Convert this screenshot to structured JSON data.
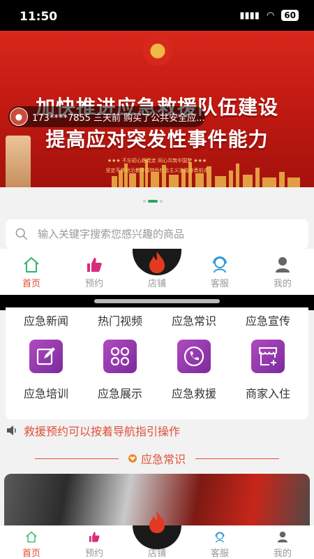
{
  "status": {
    "time": "11:50",
    "battery": "60"
  },
  "banner": {
    "line1": "加快推进应急救援队伍建设",
    "line2": "提高应对突发性事件能力",
    "slogan1": "★★★ 不忘初心跟党走 同心共筑中国梦 ★★★",
    "slogan2": "坚定不移地沿着中国特色社会主义道路奋勇前进"
  },
  "ticker": {
    "text": "173****7855 三天前 购买了公共安全应..."
  },
  "carousel": {
    "count": 3,
    "active": 1
  },
  "search": {
    "placeholder": "输入关键字搜索您感兴趣的商品"
  },
  "tabs": [
    {
      "label": "首页",
      "icon": "home-icon",
      "active": true
    },
    {
      "label": "预约",
      "icon": "thumbs-up-icon",
      "active": false
    },
    {
      "label": "店铺",
      "icon": "flame-logo-icon",
      "active": false
    },
    {
      "label": "客服",
      "icon": "headset-icon",
      "active": false
    },
    {
      "label": "我的",
      "icon": "person-icon",
      "active": false
    }
  ],
  "grid": {
    "row1": [
      "应急新闻",
      "热门视频",
      "应急常识",
      "应急宣传"
    ],
    "row2": [
      {
        "label": "应急培训",
        "icon": "edit-icon"
      },
      {
        "label": "应急展示",
        "icon": "clover-icon"
      },
      {
        "label": "应急救援",
        "icon": "phone-icon"
      },
      {
        "label": "商家入住",
        "icon": "store-add-icon"
      }
    ]
  },
  "notice": {
    "text": "救援预约可以按着导航指引操作"
  },
  "section": {
    "title": "应急常识"
  },
  "colors": {
    "accent": "#e0503a",
    "tab_active": "#e04a2e",
    "icon_purple": "#8e36a8"
  }
}
